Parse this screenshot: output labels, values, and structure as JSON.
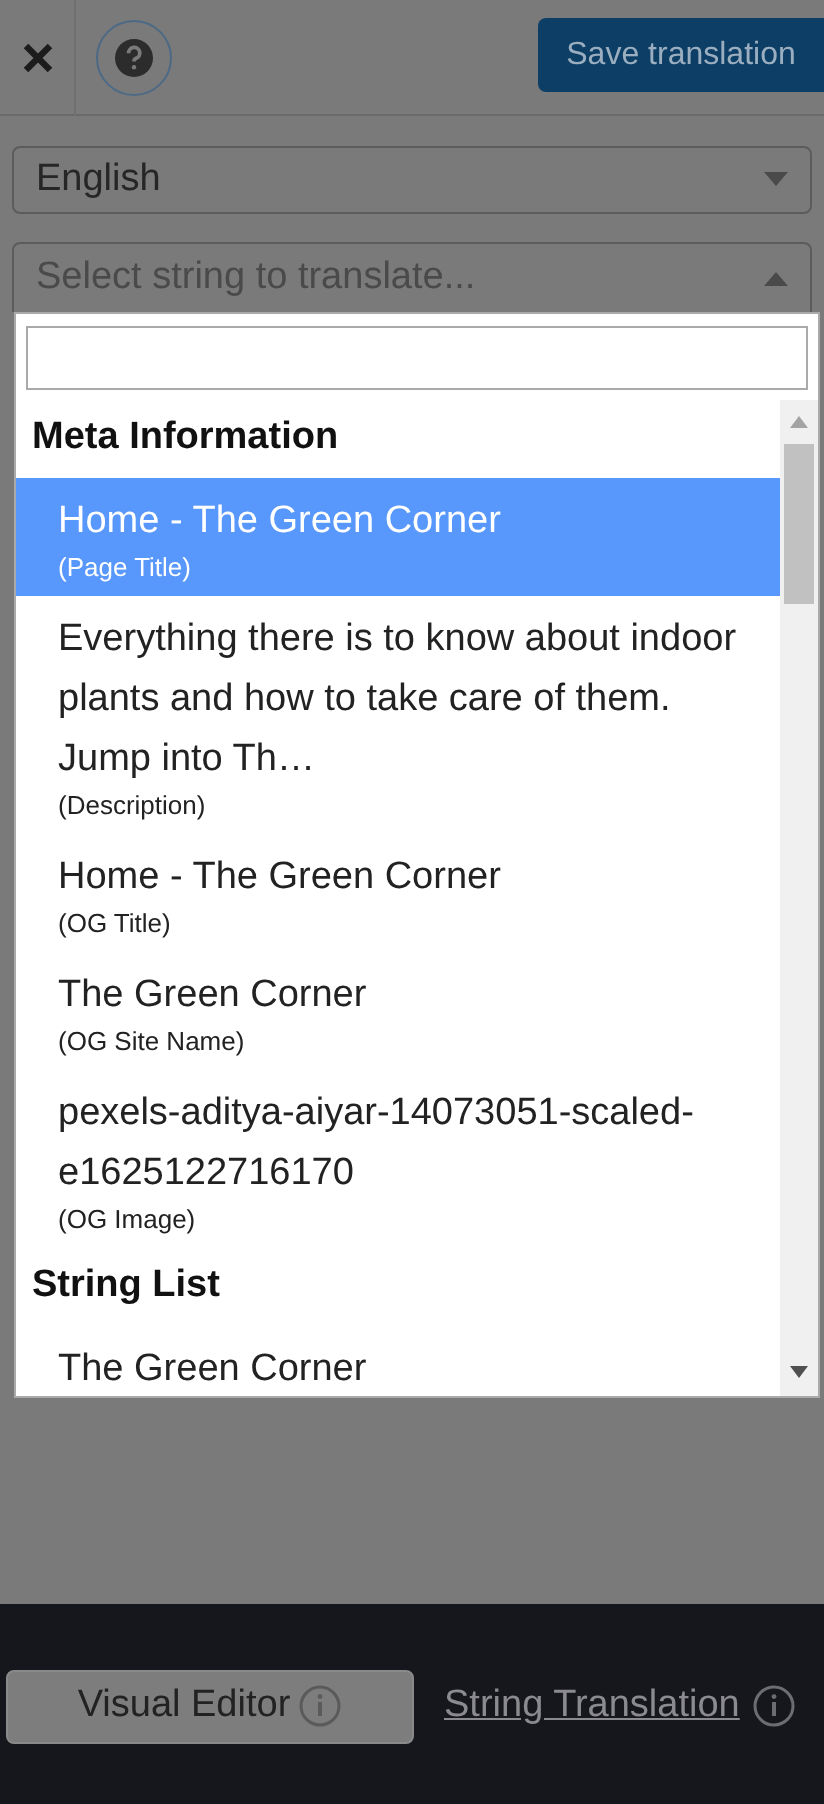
{
  "toolbar": {
    "save_button": "Save translation"
  },
  "language_select": {
    "value": "English"
  },
  "string_select": {
    "placeholder": "Select string to translate...",
    "expanded": true
  },
  "dropdown": {
    "groups": [
      {
        "title": "Meta Information",
        "items": [
          {
            "text": "Home - The Green Corner",
            "type": "(Page Title)",
            "selected": true
          },
          {
            "text": "Everything there is to know about indoor plants and how to take care of them. Jump into Th…",
            "type": "(Description)",
            "selected": false
          },
          {
            "text": "Home - The Green Corner",
            "type": "(OG Title)",
            "selected": false
          },
          {
            "text": "The Green Corner",
            "type": "(OG Site Name)",
            "selected": false
          },
          {
            "text": "pexels-aditya-aiyar-14073051-scaled-e1625122716170",
            "type": "(OG Image)",
            "selected": false
          }
        ]
      },
      {
        "title": "String List",
        "items": [
          {
            "text": "The Green Corner",
            "selected": false
          }
        ]
      }
    ]
  },
  "footer": {
    "tabs": [
      {
        "label": "Visual Editor",
        "selected": true
      },
      {
        "label": "String Translation",
        "selected": false
      }
    ]
  }
}
